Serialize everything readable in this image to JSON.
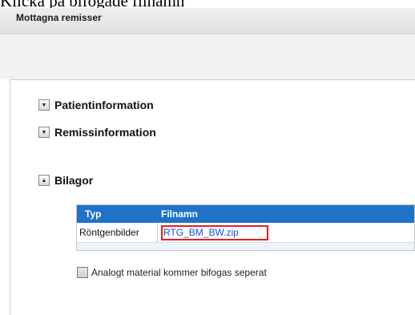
{
  "caption": "Klicka på bifogade filnamn",
  "title": "Mottagna remisser",
  "sections": [
    {
      "label": "Patientinformation",
      "state": "expand"
    },
    {
      "label": "Remissinformation",
      "state": "expand"
    },
    {
      "label": "Bilagor",
      "state": "collapse"
    }
  ],
  "icons": {
    "expand": "▼",
    "collapse": "▲"
  },
  "attachments": {
    "columns": [
      "Typ",
      "Filnamn"
    ],
    "rows": [
      {
        "typ": "Röntgenbilder",
        "filnamn": "RTG_BM_BW.zip"
      }
    ]
  },
  "analog_checkbox": {
    "label": "Analogt material kommer bifogas seperat",
    "checked": false
  },
  "colors": {
    "header_blue": "#1e73c8",
    "link_blue": "#1a4fd6",
    "highlight_red": "#e02020"
  }
}
